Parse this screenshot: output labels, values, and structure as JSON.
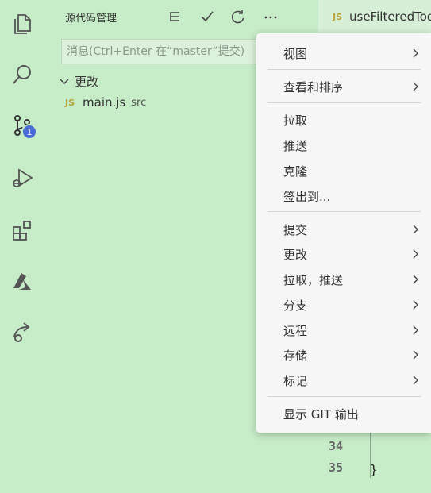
{
  "activity_bar": {
    "icons": [
      "files-icon",
      "search-icon",
      "source-control-icon",
      "run-debug-icon",
      "extensions-icon",
      "azure-icon",
      "live-share-icon"
    ],
    "source_control_badge": "1"
  },
  "sidebar": {
    "title": "源代码管理",
    "commit_input": {
      "value": "",
      "placeholder": "消息(Ctrl+Enter 在“master”提交)"
    },
    "changes_group": {
      "label": "更改",
      "files": [
        {
          "type_tag": "JS",
          "name": "main.js",
          "dir": "src"
        }
      ]
    }
  },
  "editor": {
    "tab": {
      "type_tag": "JS",
      "label": "useFilteredTodos"
    },
    "line_numbers": [
      "34",
      "35"
    ],
    "code_line": "}"
  },
  "context_menu": {
    "items": [
      {
        "label": "视图",
        "submenu": true
      },
      {
        "label": "查看和排序",
        "submenu": true
      },
      {
        "label": "拉取",
        "submenu": false
      },
      {
        "label": "推送",
        "submenu": false
      },
      {
        "label": "克隆",
        "submenu": false
      },
      {
        "label": "签出到...",
        "submenu": false
      },
      {
        "label": "提交",
        "submenu": true
      },
      {
        "label": "更改",
        "submenu": true
      },
      {
        "label": "拉取，推送",
        "submenu": true
      },
      {
        "label": "分支",
        "submenu": true
      },
      {
        "label": "远程",
        "submenu": true
      },
      {
        "label": "存储",
        "submenu": true
      },
      {
        "label": "标记",
        "submenu": true
      },
      {
        "label": "显示 GIT 输出",
        "submenu": false
      }
    ]
  },
  "colors": {
    "background": "#c7ecc8",
    "menu_background": "#f6f6f6",
    "badge": "#4b6bd6",
    "js_tag": "#b9a33a"
  }
}
